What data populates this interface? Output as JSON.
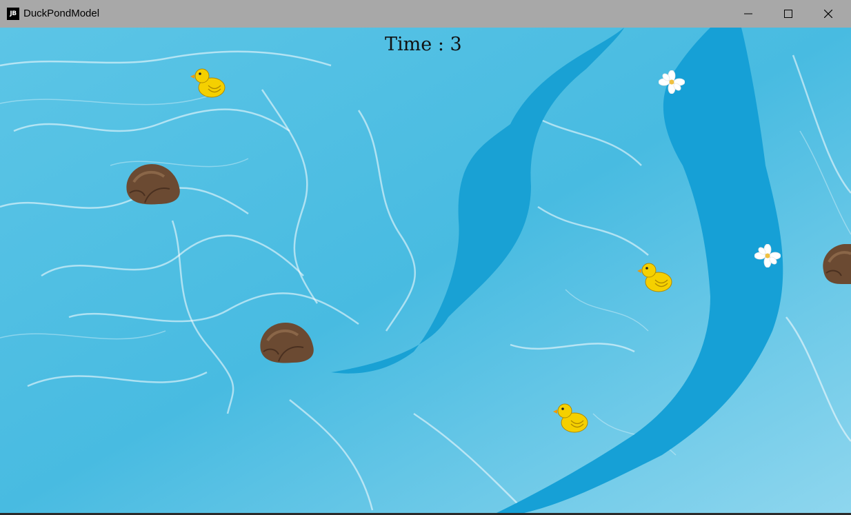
{
  "window": {
    "app_icon_text": "JB",
    "title": "DuckPondModel",
    "controls": {
      "minimize": "minimize-icon",
      "maximize": "maximize-icon",
      "close": "close-icon"
    }
  },
  "game": {
    "timer_label": "Time",
    "timer_separator": " : ",
    "timer_value": "3",
    "colors": {
      "water_light": "#6cc9e6",
      "water_mid": "#3fb6dc",
      "channel": "#1aa2d4",
      "duck": "#f5d000",
      "beak": "#f39a00",
      "rock": "#6b4a32"
    },
    "sprites": {
      "duck_icon": "rubber-duck-icon",
      "rock_icon": "rock-icon",
      "flower_icon": "water-lily-icon"
    }
  }
}
